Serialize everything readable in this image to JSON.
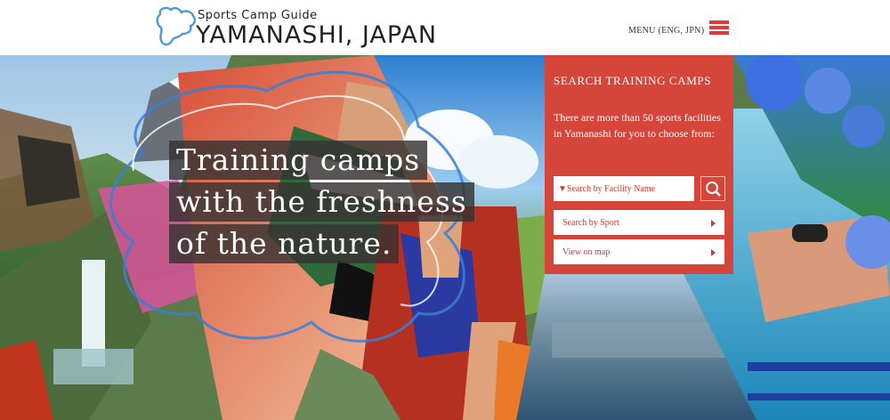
{
  "header": {
    "logo_subtitle": "Sports Camp Guide",
    "logo_title": "YAMANASHI, JAPAN",
    "menu_label": "MENU (ENG, JPN)",
    "accent_color": "#e0393a"
  },
  "hero": {
    "tagline": [
      "Training camps",
      "with the freshness",
      "of the nature."
    ]
  },
  "search_panel": {
    "title": "SEARCH TRAINING CAMPS",
    "description": "There are more than 50 sports facilities in Yamanashi for you to choose from:",
    "facility_select": "▼Search by Facility Name",
    "search_by_sport": "Search by Sport",
    "view_on_map": "View on map",
    "panel_color": "#d6453a"
  },
  "icons": [
    "yamanashi-map-logo-icon",
    "hamburger-menu-icon",
    "search-icon",
    "arrow-right-icon"
  ]
}
